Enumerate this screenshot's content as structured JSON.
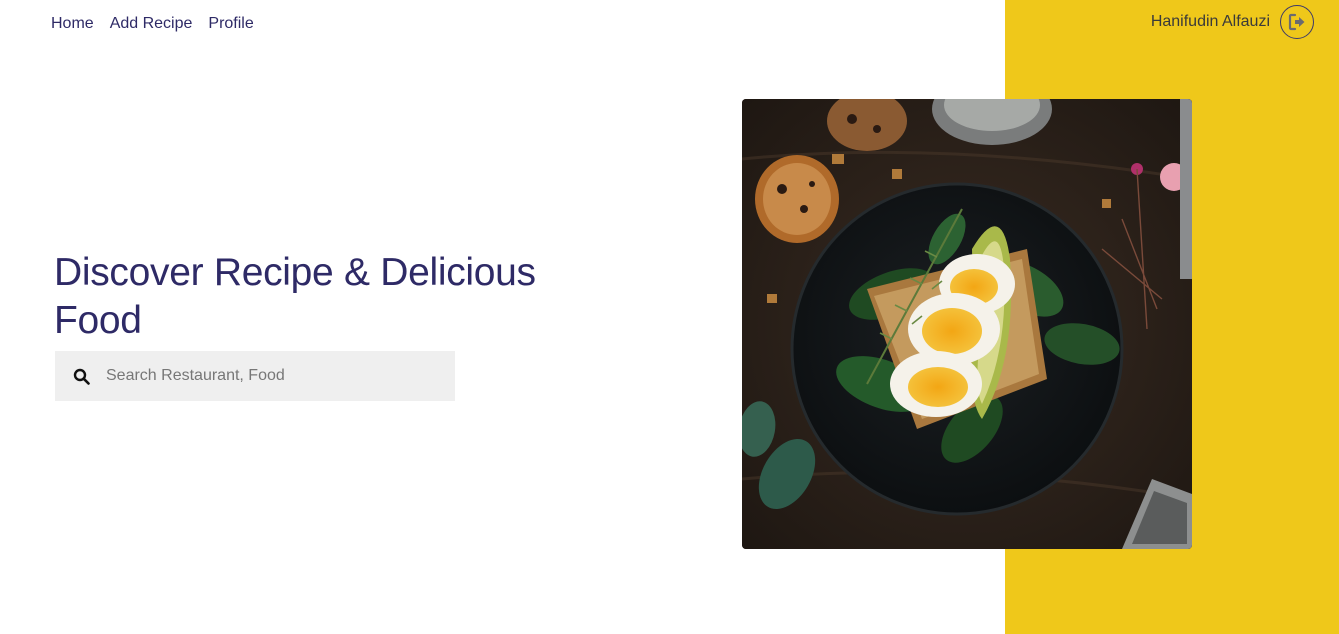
{
  "nav": {
    "items": [
      {
        "label": "Home"
      },
      {
        "label": "Add Recipe"
      },
      {
        "label": "Profile"
      }
    ]
  },
  "user": {
    "name": "Hanifudin Alfauzi",
    "logout_icon": "logout-icon"
  },
  "hero": {
    "title": "Discover Recipe & Delicious Food",
    "image_icon": "food-photo"
  },
  "search": {
    "placeholder": "Search Restaurant, Food",
    "value": "",
    "icon": "search-icon"
  },
  "colors": {
    "accent": "#efc81a",
    "primary_text": "#2e2a66",
    "search_bg": "#efefef"
  }
}
